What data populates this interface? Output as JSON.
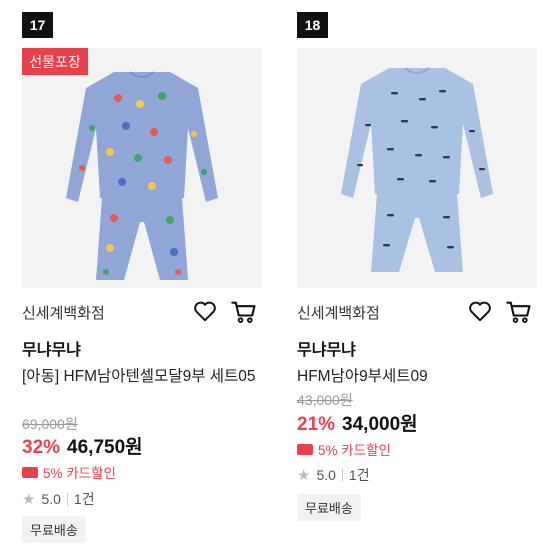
{
  "colors": {
    "accent_red": "#e8414c",
    "rank_bg": "#111111",
    "image_bg": "#f3f3f3",
    "pajama_blue": "#8fa6d6",
    "pajama_blue_light": "#a9c1e3"
  },
  "products": [
    {
      "rank": "17",
      "badge": "선물포장",
      "brand": "신세계백화점",
      "shop": "무냐무냐",
      "name": "[아동] HFM남아텐셀모달9부 세트05",
      "original_price": "69,000원",
      "discount": "32%",
      "price": "46,750원",
      "card_discount": "5% 카드할인",
      "rating": "5.0",
      "review_count": "1건",
      "shipping": "무료배송",
      "icons": [
        "heart-icon",
        "cart-icon",
        "star-icon",
        "card-icon"
      ]
    },
    {
      "rank": "18",
      "brand": "신세계백화점",
      "shop": "무냐무냐",
      "name": "HFM남아9부세트09",
      "original_price": "43,000원",
      "discount": "21%",
      "price": "34,000원",
      "card_discount": "5% 카드할인",
      "rating": "5.0",
      "review_count": "1건",
      "shipping": "무료배송",
      "icons": [
        "heart-icon",
        "cart-icon",
        "star-icon",
        "card-icon"
      ]
    }
  ]
}
